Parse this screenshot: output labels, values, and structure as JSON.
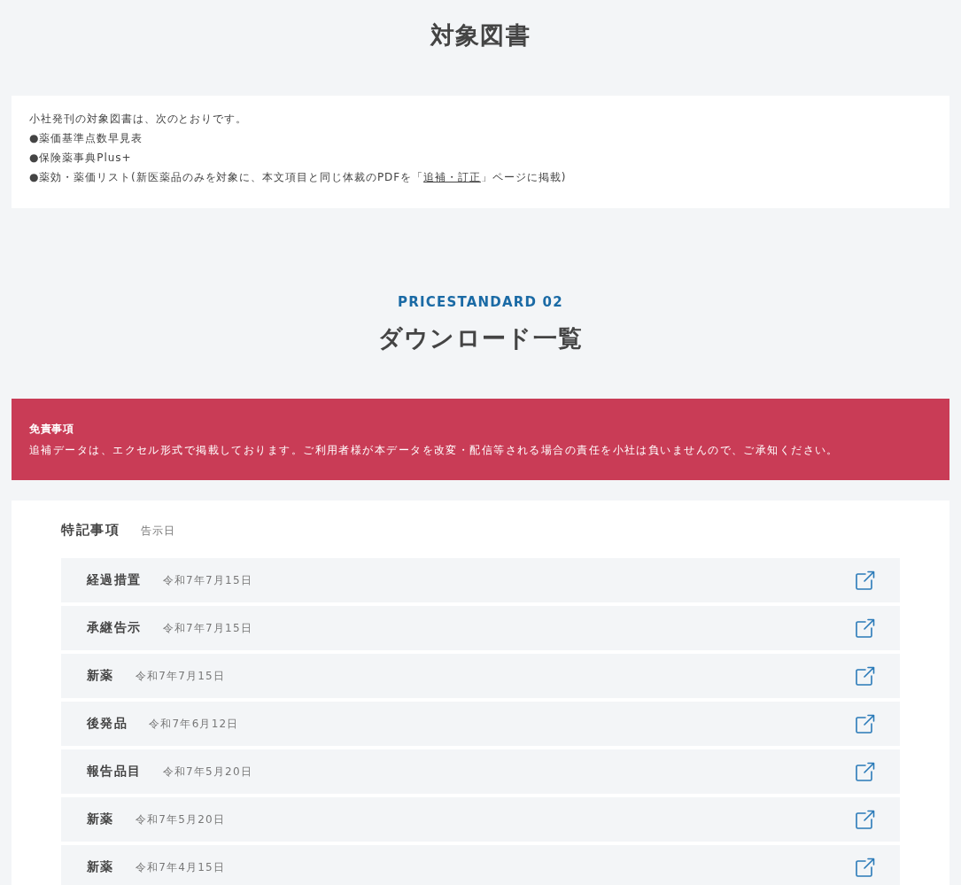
{
  "section_1": {
    "title": "対象図書"
  },
  "books_card": {
    "intro": "小社発刊の対象図書は、次のとおりです。",
    "items": [
      {
        "text": "●薬価基準点数早見表"
      },
      {
        "text": "●保険薬事典Plus+"
      },
      {
        "text": "●薬効・薬価リスト(新医薬品のみを対象に、本文項目と同じ体裁のPDFを「",
        "link": "追補・訂正",
        "text_after": "」ページに掲載)"
      }
    ]
  },
  "section_2": {
    "label": "PRICESTANDARD 02",
    "title": "ダウンロード一覧"
  },
  "disclaimer": {
    "title": "免責事項",
    "text": "追補データは、エクセル形式で掲載しております。ご利用者様が本データを改変・配信等される場合の責任を小社は負いませんので、ご承知ください。"
  },
  "downloads": {
    "header": "特記事項",
    "header_date": "告示日",
    "rows": [
      {
        "name": "経過措置",
        "date": "令和7年7月15日"
      },
      {
        "name": "承継告示",
        "date": "令和7年7月15日"
      },
      {
        "name": "新薬",
        "date": "令和7年7月15日"
      },
      {
        "name": "後発品",
        "date": "令和7年6月12日"
      },
      {
        "name": "報告品目",
        "date": "令和7年5月20日"
      },
      {
        "name": "新薬",
        "date": "令和7年5月20日"
      },
      {
        "name": "新薬",
        "date": "令和7年4月15日"
      }
    ]
  }
}
